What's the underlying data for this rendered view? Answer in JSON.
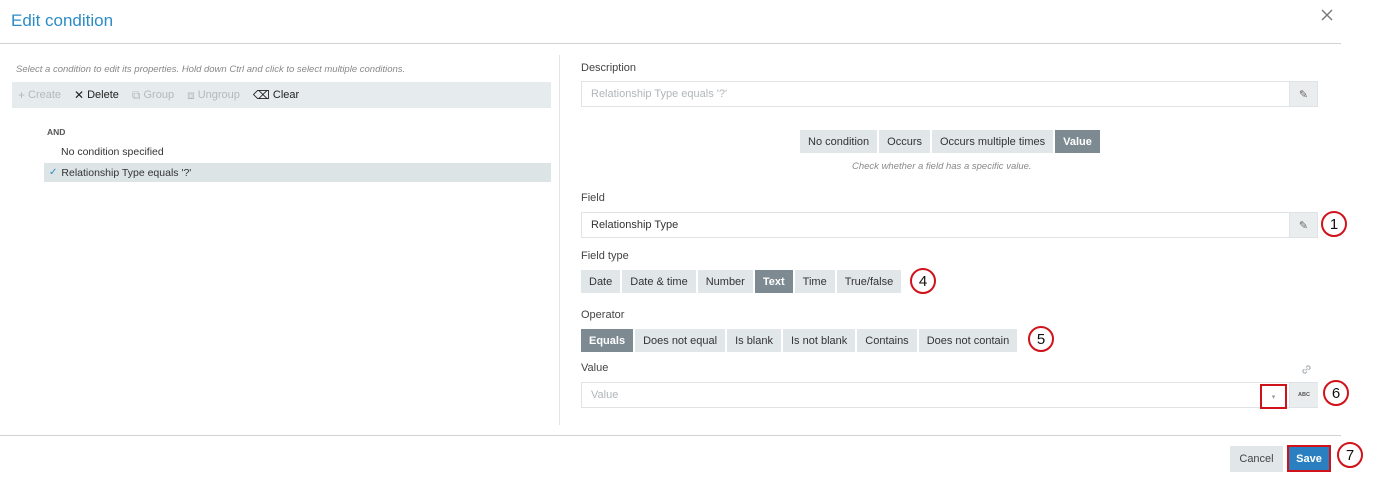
{
  "dialog": {
    "title": "Edit condition"
  },
  "left": {
    "hint": "Select a condition to edit its properties. Hold down Ctrl and click to select multiple conditions.",
    "toolbar": {
      "create": "Create",
      "delete": "Delete",
      "group": "Group",
      "ungroup": "Ungroup",
      "clear": "Clear"
    },
    "tree": {
      "operator": "AND",
      "items": [
        "No condition specified",
        "Relationship Type equals '?'"
      ]
    }
  },
  "right": {
    "description": {
      "label": "Description",
      "placeholder": "Relationship Type  equals '?'"
    },
    "condition_modes": [
      "No condition",
      "Occurs",
      "Occurs multiple times",
      "Value"
    ],
    "condition_mode_selected": "Value",
    "mode_help": "Check whether a field has a specific value.",
    "field": {
      "label": "Field",
      "value": "Relationship Type"
    },
    "field_type": {
      "label": "Field type",
      "options": [
        "Date",
        "Date & time",
        "Number",
        "Text",
        "Time",
        "True/false"
      ],
      "selected": "Text"
    },
    "operator": {
      "label": "Operator",
      "options": [
        "Equals",
        "Does not equal",
        "Is blank",
        "Is not blank",
        "Contains",
        "Does not contain"
      ],
      "selected": "Equals"
    },
    "value": {
      "label": "Value",
      "placeholder": "Value",
      "type_badge": "ABC"
    }
  },
  "footer": {
    "cancel": "Cancel",
    "save": "Save"
  },
  "annotations": [
    "1",
    "4",
    "5",
    "6",
    "7"
  ],
  "colors": {
    "accent": "#2a8cc7",
    "active_segment": "#7d8a92",
    "annotation": "#d0121b"
  }
}
